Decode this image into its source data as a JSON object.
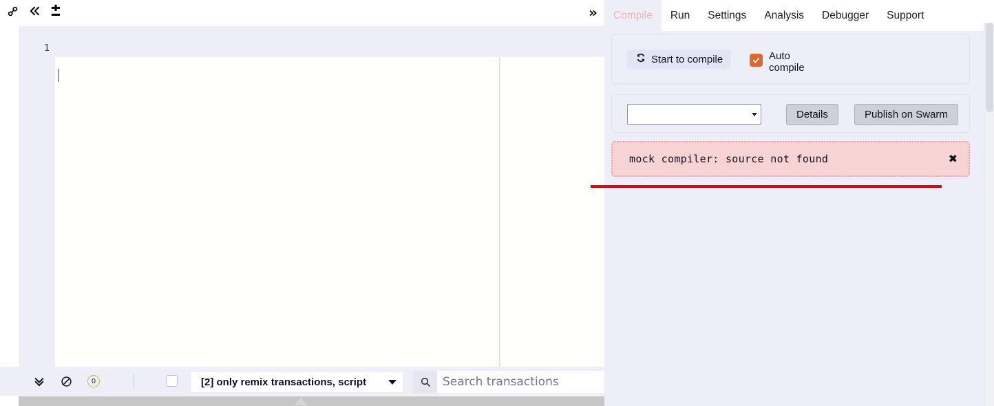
{
  "topbar": {
    "icons": [
      {
        "name": "link-icon",
        "label": "Link"
      },
      {
        "name": "collapse-left-icon",
        "label": "«"
      },
      {
        "name": "plus-minus-icon",
        "label": "±"
      }
    ],
    "expand_right_label": "»"
  },
  "tabs": [
    {
      "label": "Compile",
      "active": true
    },
    {
      "label": "Run",
      "active": false
    },
    {
      "label": "Settings",
      "active": false
    },
    {
      "label": "Analysis",
      "active": false
    },
    {
      "label": "Debugger",
      "active": false
    },
    {
      "label": "Support",
      "active": false
    }
  ],
  "editor": {
    "line_numbers": [
      "1"
    ],
    "content": ""
  },
  "bottom_toolbar": {
    "expand_all_icon": "chevron-double-down-icon",
    "clear_icon": "ban-icon",
    "count_badge": "0",
    "show_all_checkbox_checked": false,
    "filter_select_value": "[2] only remix transactions, script",
    "search_placeholder": "Search transactions",
    "search_value": ""
  },
  "compile_panel": {
    "start_button_label": "Start to compile",
    "start_button_icon": "refresh-icon",
    "auto_compile_label": "Auto compile",
    "auto_compile_checked": true,
    "version_select_value": "",
    "details_button_label": "Details",
    "swarm_button_label": "Publish on Swarm",
    "error_message": "mock compiler: source not found",
    "error_close_label": "✖"
  },
  "colors": {
    "panel_bg": "#eeeef8",
    "active_tab_text": "#f3b3b3",
    "checkbox_orange": "#e0672c",
    "error_bg": "#f7d3d3",
    "error_border": "#e3a6a6",
    "red_rule": "#cc1111",
    "badge_border": "#d8b54a",
    "button_gray": "#cfcfd8"
  }
}
